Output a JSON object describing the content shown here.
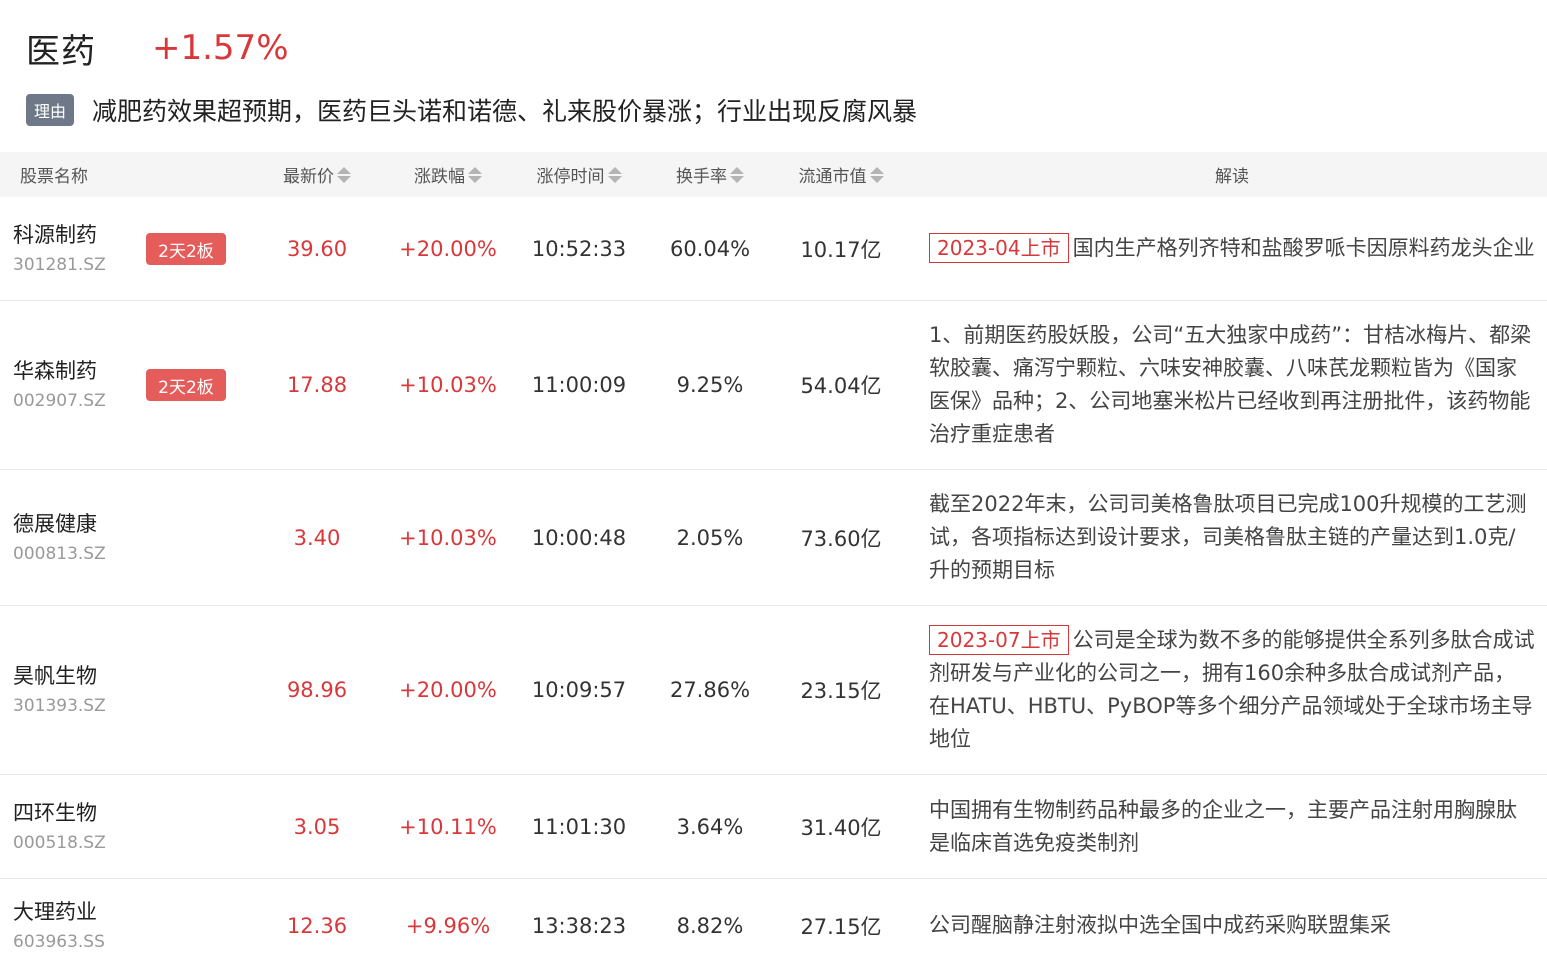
{
  "sector": {
    "name": "医药",
    "change": "+1.57%"
  },
  "reason": {
    "tag": "理由",
    "text": "减肥药效果超预期，医药巨头诺和诺德、礼来股价暴涨；行业出现反腐风暴"
  },
  "columns": {
    "name": "股票名称",
    "price": "最新价",
    "change": "涨跌幅",
    "limit_time": "涨停时间",
    "turnover": "换手率",
    "market_cap": "流通市值",
    "analysis": "解读"
  },
  "rows": [
    {
      "name": "科源制药",
      "code": "301281.SZ",
      "badge": "2天2板",
      "price": "39.60",
      "change": "+20.00%",
      "limit_time": "10:52:33",
      "turnover": "60.04%",
      "market_cap": "10.17亿",
      "listing": "2023-04上市",
      "analysis": "国内生产格列齐特和盐酸罗哌卡因原料药龙头企业"
    },
    {
      "name": "华森制药",
      "code": "002907.SZ",
      "badge": "2天2板",
      "price": "17.88",
      "change": "+10.03%",
      "limit_time": "11:00:09",
      "turnover": "9.25%",
      "market_cap": "54.04亿",
      "listing": "",
      "analysis": "1、前期医药股妖股，公司“五大独家中成药”：甘桔冰梅片、都梁软胶囊、痛泻宁颗粒、六味安神胶囊、八味芪龙颗粒皆为《国家医保》品种；2、公司地塞米松片已经收到再注册批件，该药物能治疗重症患者"
    },
    {
      "name": "德展健康",
      "code": "000813.SZ",
      "badge": "",
      "price": "3.40",
      "change": "+10.03%",
      "limit_time": "10:00:48",
      "turnover": "2.05%",
      "market_cap": "73.60亿",
      "listing": "",
      "analysis": "截至2022年末，公司司美格鲁肽项目已完成100升规模的工艺测试，各项指标达到设计要求，司美格鲁肽主链的产量达到1.0克/升的预期目标"
    },
    {
      "name": "昊帆生物",
      "code": "301393.SZ",
      "badge": "",
      "price": "98.96",
      "change": "+20.00%",
      "limit_time": "10:09:57",
      "turnover": "27.86%",
      "market_cap": "23.15亿",
      "listing": "2023-07上市",
      "analysis": "公司是全球为数不多的能够提供全系列多肽合成试剂研发与产业化的公司之一，拥有160余种多肽合成试剂产品，在HATU、HBTU、PyBOP等多个细分产品领域处于全球市场主导地位"
    },
    {
      "name": "四环生物",
      "code": "000518.SZ",
      "badge": "",
      "price": "3.05",
      "change": "+10.11%",
      "limit_time": "11:01:30",
      "turnover": "3.64%",
      "market_cap": "31.40亿",
      "listing": "",
      "analysis": "中国拥有生物制药品种最多的企业之一，主要产品注射用胸腺肽是临床首选免疫类制剂"
    },
    {
      "name": "大理药业",
      "code": "603963.SS",
      "badge": "",
      "price": "12.36",
      "change": "+9.96%",
      "limit_time": "13:38:23",
      "turnover": "8.82%",
      "market_cap": "27.15亿",
      "listing": "",
      "analysis": "公司醒脑静注射液拟中选全国中成药采购联盟集采"
    }
  ]
}
